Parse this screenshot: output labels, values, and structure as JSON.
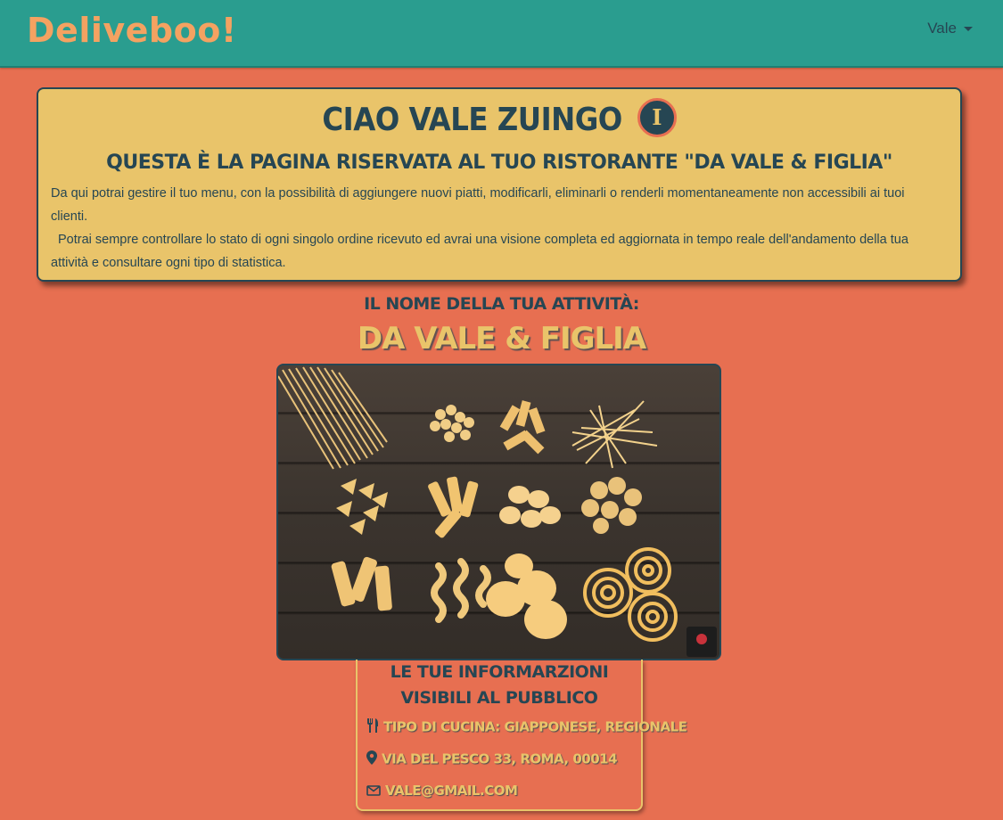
{
  "navbar": {
    "brand": "Deliveboo!",
    "user_name": "Vale"
  },
  "welcome": {
    "title": "Ciao Vale Zuingo",
    "subtitle": "Questa è la pagina riservata al tuo ristorante \"Da Vale & Figlia\"",
    "paragraph_1": "Da qui potrai gestire il tuo menu, con la possibilità di aggiungere nuovi piatti, modificarli, eliminarli o renderli momentaneamente non accessibili ai tuoi clienti.",
    "paragraph_2": "Potrai sempre controllare lo stato di ogni singolo ordine ricevuto ed avrai una visione completa ed aggiornata in tempo reale dell'andamento della tua attività e consultare ogni tipo di statistica."
  },
  "business": {
    "label": "Il nome della tua attività:",
    "name": "Da Vale & Figlia"
  },
  "public_info": {
    "title": "Le tue informarzioni visibili al pubblico",
    "cuisine": "Tipo di cucina: Giapponese, Regionale",
    "address": "Via del Pesco 33, Roma, 00014",
    "email": "vale@gmail.com"
  },
  "icons": {
    "info": "info-icon",
    "cuisine": "utensils-icon",
    "address": "map-marker-icon",
    "email": "envelope-icon"
  },
  "colors": {
    "navbar": "#2a9d8f",
    "background": "#e76f51",
    "card": "#e9c46a",
    "text_dark": "#264653",
    "brand": "#f4a261"
  }
}
